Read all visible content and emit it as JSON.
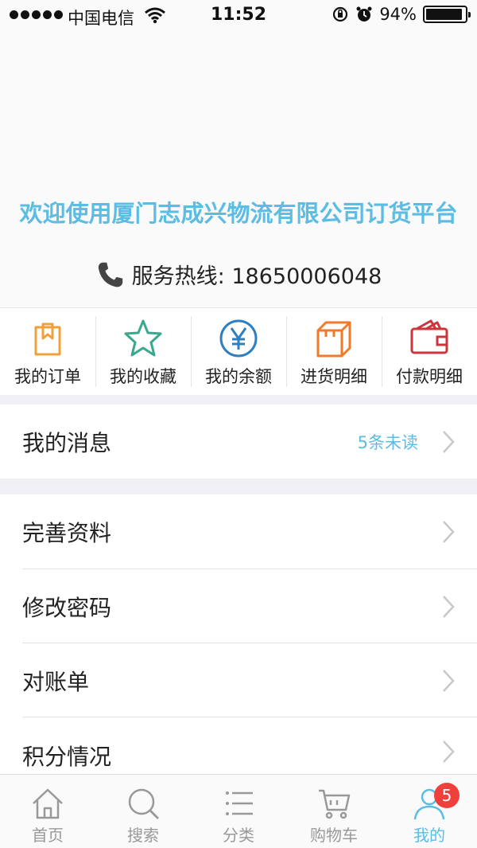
{
  "status_bar": {
    "carrier": "中国电信",
    "time": "11:52",
    "battery": "94%",
    "battery_level": 0.94
  },
  "header": {
    "welcome": "欢迎使用厦门志成兴物流有限公司订货平台",
    "hotline_label": "服务热线: 18650006048"
  },
  "actions": [
    {
      "label": "我的订单",
      "icon": "order-bag-icon",
      "color": "#f0a13c"
    },
    {
      "label": "我的收藏",
      "icon": "star-icon",
      "color": "#3aa88f"
    },
    {
      "label": "我的余额",
      "icon": "yen-icon",
      "color": "#2e7fc1"
    },
    {
      "label": "进货明细",
      "icon": "box-icon",
      "color": "#f07a2a"
    },
    {
      "label": "付款明细",
      "icon": "wallet-icon",
      "color": "#c9363c"
    }
  ],
  "messages": {
    "label": "我的消息",
    "badge": "5条未读"
  },
  "menu": [
    {
      "label": "完善资料"
    },
    {
      "label": "修改密码"
    },
    {
      "label": "对账单"
    },
    {
      "label": "积分情况"
    }
  ],
  "tabbar": {
    "tabs": [
      {
        "label": "首页",
        "icon": "home-icon"
      },
      {
        "label": "搜索",
        "icon": "search-icon"
      },
      {
        "label": "分类",
        "icon": "list-icon"
      },
      {
        "label": "购物车",
        "icon": "cart-icon"
      },
      {
        "label": "我的",
        "icon": "user-icon",
        "badge": "5"
      }
    ],
    "active_index": 4
  },
  "colors": {
    "accent": "#5bbce4",
    "badge_red": "#f0403c"
  }
}
